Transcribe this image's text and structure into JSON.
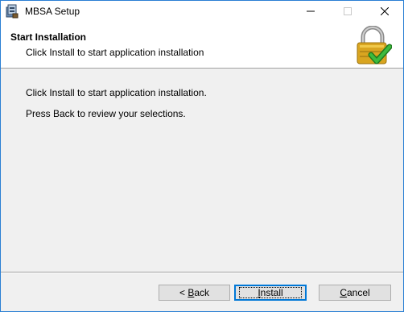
{
  "window": {
    "title": "MBSA Setup"
  },
  "icons": {
    "app": "setup-package-icon",
    "minimize": "minimize-icon",
    "maximize": "maximize-icon",
    "close": "close-icon",
    "header": "padlock-checkmark-icon",
    "back_arrow": "chevron-left-icon"
  },
  "header": {
    "title": "Start Installation",
    "subtitle": "Click Install to start application installation"
  },
  "body": {
    "line1": "Click Install to start application installation.",
    "line2": "Press Back to review your selections."
  },
  "buttons": {
    "back_prefix": "< ",
    "back_access_key": "B",
    "back_rest": "ack",
    "install_access_key": "I",
    "install_rest": "nstall",
    "cancel_access_key": "C",
    "cancel_rest": "ancel"
  },
  "colors": {
    "accent": "#0078d7",
    "window_border": "#2a7fd4",
    "lock_gold": "#d9a520",
    "check_green": "#2e9e2e"
  }
}
